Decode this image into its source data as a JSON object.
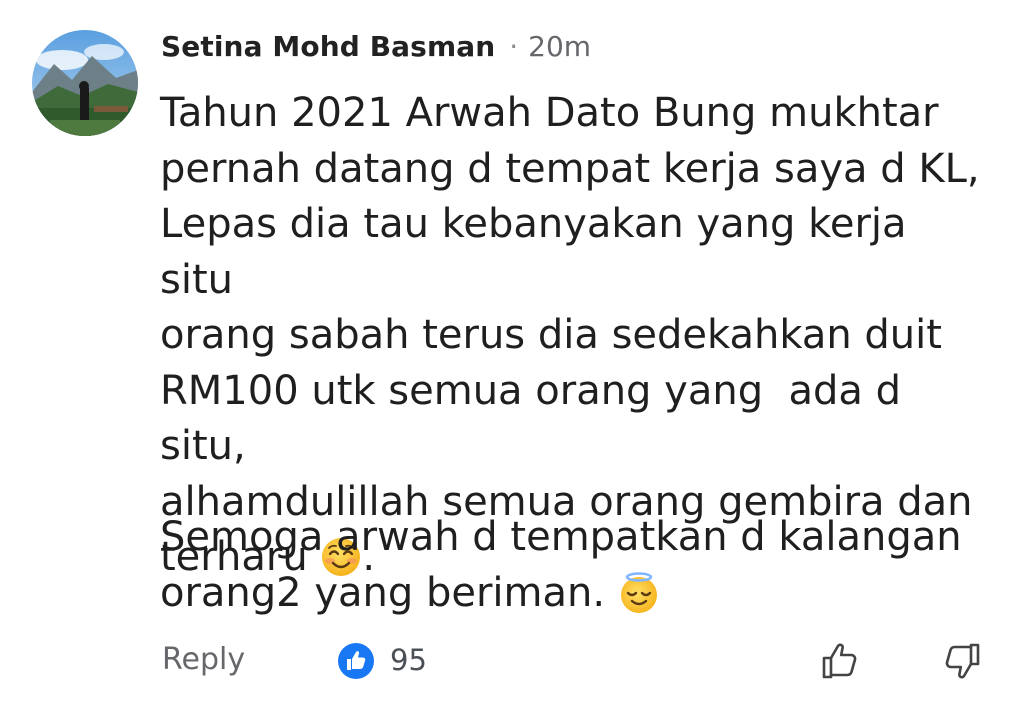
{
  "comment": {
    "author": "Setina Mohd Basman",
    "separator": "·",
    "time": "20m",
    "paragraph1": "Tahun 2021 Arwah Dato Bung mukhtar\npernah datang d tempat kerja saya d KL,\nLepas dia tau kebanyakan yang kerja situ\norang sabah terus dia sedekahkan duit\nRM100 utk semua orang yang  ada d situ,\nalhamdulillah semua orang gembira dan\nterharu",
    "paragraph1_end": ".",
    "paragraph2": "Semoga arwah d tempatkan d kalangan\norang2 yang beriman.",
    "emoji1": "smiling-blush-emoji",
    "emoji2": "halo-angel-emoji"
  },
  "footer": {
    "reply_label": "Reply",
    "like_count": "95",
    "like_badge_icon": "thumbs-up-badge-icon",
    "like_button_icon": "thumbs-up-outline-icon",
    "dislike_button_icon": "thumbs-down-outline-icon"
  },
  "colors": {
    "like_blue": "#1877f2",
    "meta_gray": "#65676b",
    "text": "#1f1f1f"
  }
}
